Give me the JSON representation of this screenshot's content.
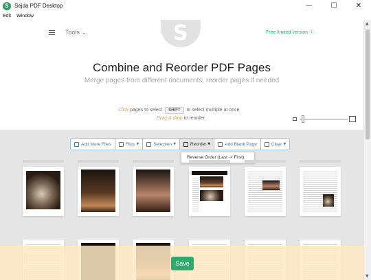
{
  "window": {
    "title": "Sejda PDF Desktop",
    "logo_letter": "S",
    "minimize": "—",
    "maximize": "☐",
    "close": "✕"
  },
  "menu": [
    "Edit",
    "Window"
  ],
  "header": {
    "tools_label": "Tools",
    "tools_caret": "⌄",
    "free_version": "Free limited version ⓘ",
    "title": "Combine and Reorder PDF Pages",
    "subtitle": "Merge pages from different documents, reorder pages if needed",
    "hint_click": "Click",
    "hint_click_rest": " pages to select ",
    "shift_key": "SHIFT",
    "hint_shift_rest": " to select multiple at once",
    "hint_drag": "Drag & drop",
    "hint_drag_rest": " to reorder"
  },
  "zoom": {
    "level": 0.05
  },
  "toolbar": {
    "add_more_files": "Add More Files",
    "files": "Files",
    "selection": "Selection",
    "reorder": "Reorder",
    "add_blank_page": "Add Blank Page",
    "clear": "Clear"
  },
  "reorder_dropdown": {
    "option": "Reverse Order (Last -> First)"
  },
  "footer": {
    "save": "Save"
  },
  "colors": {
    "accent_green": "#2bab6e",
    "toolbar_blue": "#3a7bb5",
    "hint_orange": "#d0a15e"
  }
}
